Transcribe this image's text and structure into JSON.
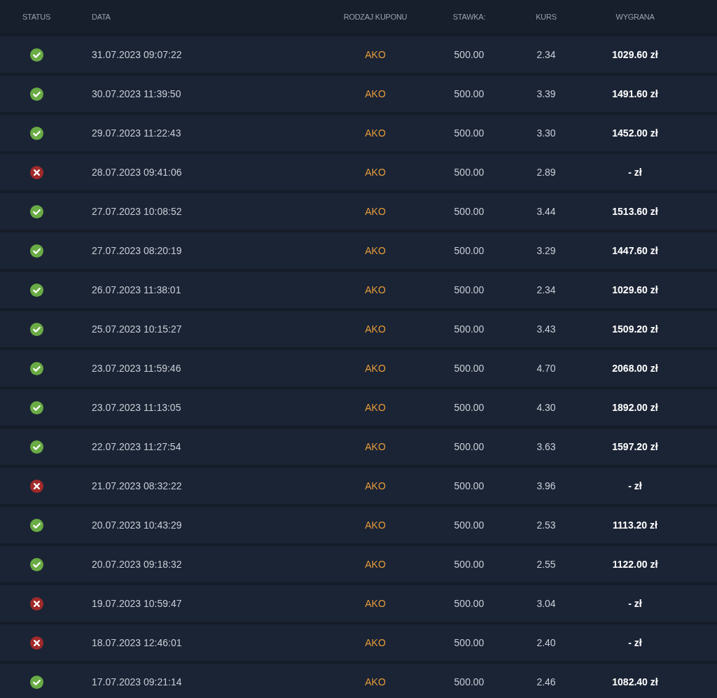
{
  "table": {
    "columns": [
      "STATUS",
      "DATA",
      "RODZAJ KUPONU",
      "STAWKA:",
      "KURS",
      "WYGRANA"
    ],
    "rows": [
      {
        "won": true,
        "date": "31.07.2023 09:07:22",
        "type": "AKO",
        "stake": "500.00",
        "odds": "2.34",
        "win": "1029.60 zł"
      },
      {
        "won": true,
        "date": "30.07.2023 11:39:50",
        "type": "AKO",
        "stake": "500.00",
        "odds": "3.39",
        "win": "1491.60 zł"
      },
      {
        "won": true,
        "date": "29.07.2023 11:22:43",
        "type": "AKO",
        "stake": "500.00",
        "odds": "3.30",
        "win": "1452.00 zł"
      },
      {
        "won": false,
        "date": "28.07.2023 09:41:06",
        "type": "AKO",
        "stake": "500.00",
        "odds": "2.89",
        "win": "- zł"
      },
      {
        "won": true,
        "date": "27.07.2023 10:08:52",
        "type": "AKO",
        "stake": "500.00",
        "odds": "3.44",
        "win": "1513.60 zł"
      },
      {
        "won": true,
        "date": "27.07.2023 08:20:19",
        "type": "AKO",
        "stake": "500.00",
        "odds": "3.29",
        "win": "1447.60 zł"
      },
      {
        "won": true,
        "date": "26.07.2023 11:38:01",
        "type": "AKO",
        "stake": "500.00",
        "odds": "2.34",
        "win": "1029.60 zł"
      },
      {
        "won": true,
        "date": "25.07.2023 10:15:27",
        "type": "AKO",
        "stake": "500.00",
        "odds": "3.43",
        "win": "1509.20 zł"
      },
      {
        "won": true,
        "date": "23.07.2023 11:59:46",
        "type": "AKO",
        "stake": "500.00",
        "odds": "4.70",
        "win": "2068.00 zł"
      },
      {
        "won": true,
        "date": "23.07.2023 11:13:05",
        "type": "AKO",
        "stake": "500.00",
        "odds": "4.30",
        "win": "1892.00 zł"
      },
      {
        "won": true,
        "date": "22.07.2023 11:27:54",
        "type": "AKO",
        "stake": "500.00",
        "odds": "3.63",
        "win": "1597.20 zł"
      },
      {
        "won": false,
        "date": "21.07.2023 08:32:22",
        "type": "AKO",
        "stake": "500.00",
        "odds": "3.96",
        "win": "- zł"
      },
      {
        "won": true,
        "date": "20.07.2023 10:43:29",
        "type": "AKO",
        "stake": "500.00",
        "odds": "2.53",
        "win": "1113.20 zł"
      },
      {
        "won": true,
        "date": "20.07.2023 09:18:32",
        "type": "AKO",
        "stake": "500.00",
        "odds": "2.55",
        "win": "1122.00 zł"
      },
      {
        "won": false,
        "date": "19.07.2023 10:59:47",
        "type": "AKO",
        "stake": "500.00",
        "odds": "3.04",
        "win": "- zł"
      },
      {
        "won": false,
        "date": "18.07.2023 12:46:01",
        "type": "AKO",
        "stake": "500.00",
        "odds": "2.40",
        "win": "- zł"
      },
      {
        "won": true,
        "date": "17.07.2023 09:21:14",
        "type": "AKO",
        "stake": "500.00",
        "odds": "2.46",
        "win": "1082.40 zł"
      }
    ]
  }
}
